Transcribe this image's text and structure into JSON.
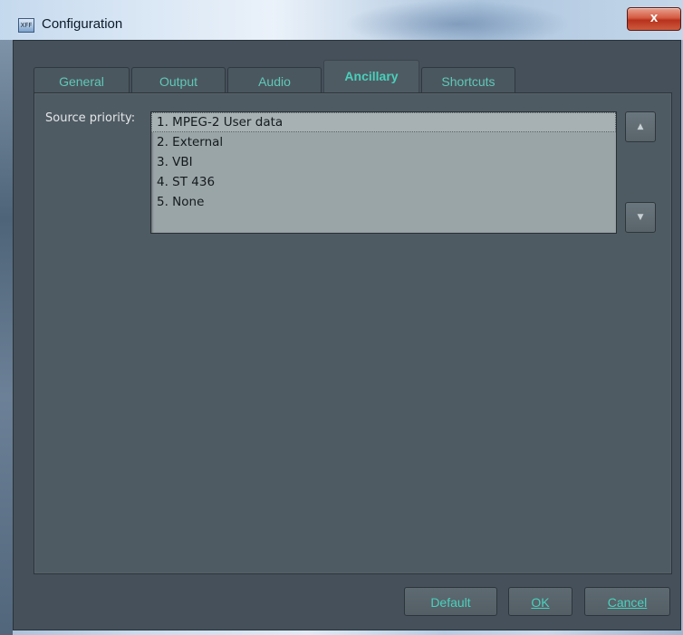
{
  "window": {
    "title": "Configuration",
    "app_icon_text": "XFF",
    "close_label": "x"
  },
  "tabs": [
    {
      "label": "General",
      "active": false
    },
    {
      "label": "Output",
      "active": false
    },
    {
      "label": "Audio",
      "active": false
    },
    {
      "label": "Ancillary",
      "active": true
    },
    {
      "label": "Shortcuts",
      "active": false
    }
  ],
  "ancillary": {
    "source_priority_label": "Source priority:",
    "items": [
      "1. MPEG-2 User data",
      "2. External",
      "3. VBI",
      "4. ST 436",
      "5. None"
    ],
    "selected_index": 0,
    "move_up_glyph": "▲",
    "move_down_glyph": "▼"
  },
  "buttons": {
    "default_label": "Default",
    "ok_label": "OK",
    "cancel_label": "Cancel"
  },
  "colors": {
    "accent": "#49d0bb",
    "panel": "#4f5b63",
    "client": "#45505a",
    "listbox": "#9aa5a8"
  }
}
